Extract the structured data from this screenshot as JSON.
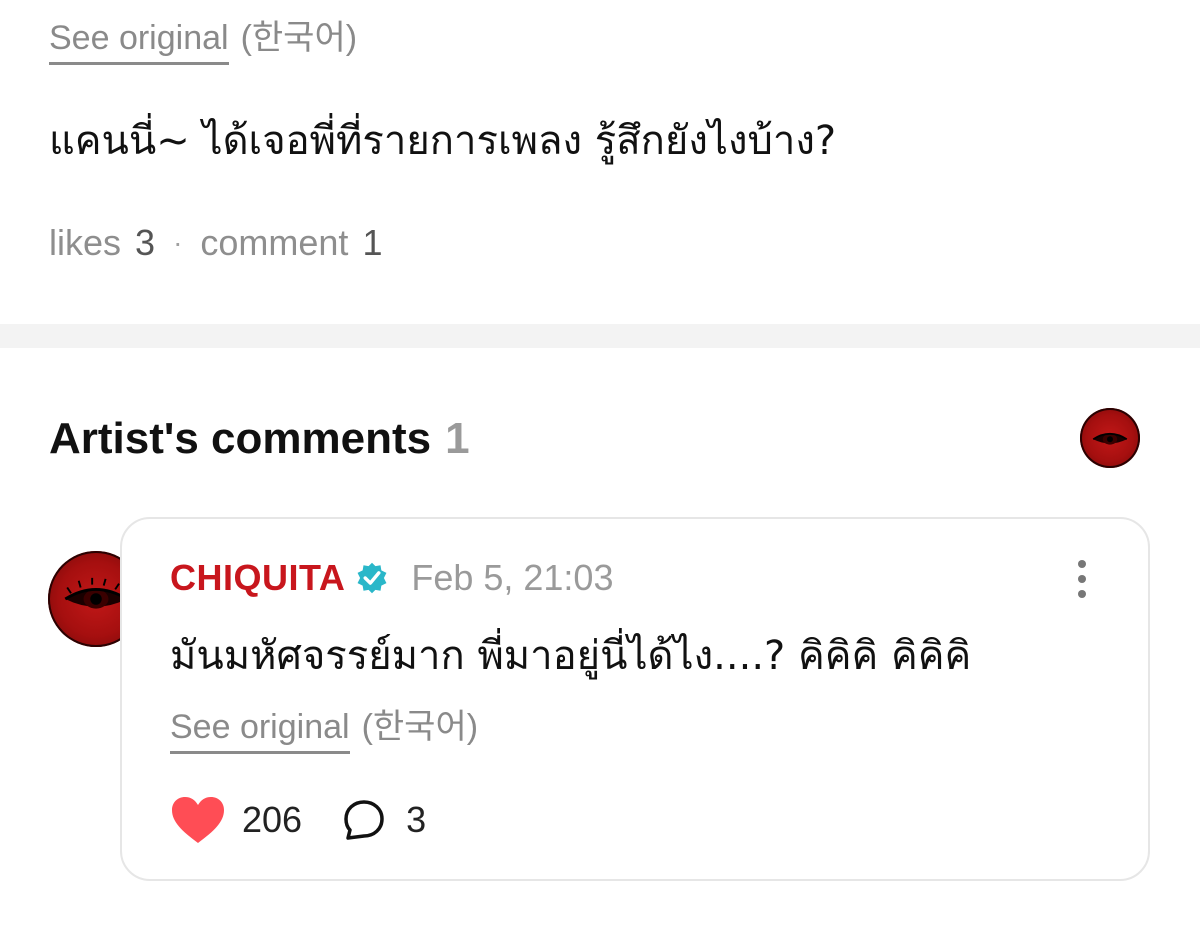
{
  "post": {
    "see_original_label": "See original",
    "language_label": "(한국어)",
    "text": "แคนนี่~ ได้เจอพี่ที่รายการเพลง รู้สึกยังไงบ้าง?",
    "likes_label": "likes",
    "likes_count": "3",
    "separator": "·",
    "comment_label": "comment",
    "comment_count": "1"
  },
  "artist_comments": {
    "title": "Artist's comments",
    "count": "1"
  },
  "comment": {
    "author": "CHIQUITA",
    "verified_icon": "verified-badge-icon",
    "timestamp": "Feb 5, 21:03",
    "text": "มันมหัศจรรย์มาก พี่มาอยู่นี่ได้ไง....? คิคิคิ คิคิคิ",
    "see_original_label": "See original",
    "language_label": "(한국어)",
    "likes": "206",
    "replies": "3"
  },
  "colors": {
    "author": "#c8161d",
    "heart": "#ff4d55",
    "verified": "#2ab7c9",
    "muted": "#8a8a8a"
  }
}
